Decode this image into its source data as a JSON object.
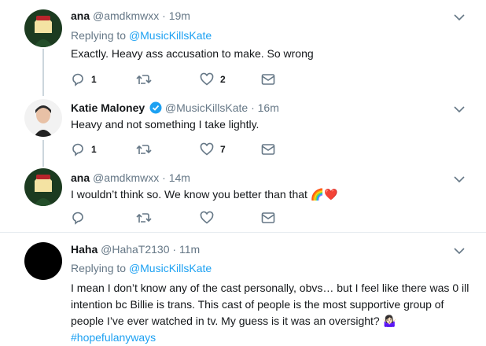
{
  "tweets": [
    {
      "name": "ana",
      "handle": "@amdkmwxx",
      "dot": "·",
      "time": "19m",
      "replying_prefix": "Replying to ",
      "replying_to": "@MusicKillsKate",
      "text": "Exactly. Heavy ass accusation to make. So wrong",
      "reply_count": "1",
      "retweet_count": "",
      "like_count": "2"
    },
    {
      "name": "Katie Maloney",
      "handle": "@MusicKillsKate",
      "dot": "·",
      "time": "16m",
      "text": "Heavy and not something I take lightly.",
      "reply_count": "1",
      "retweet_count": "",
      "like_count": "7"
    },
    {
      "name": "ana",
      "handle": "@amdkmwxx",
      "dot": "·",
      "time": "14m",
      "text": "I wouldn’t think so. We know you better than that",
      "emoji": "🌈❤️",
      "reply_count": "",
      "retweet_count": "",
      "like_count": ""
    },
    {
      "name": "Haha",
      "handle": "@HahaT2130",
      "dot": "·",
      "time": "11m",
      "replying_prefix": "Replying to ",
      "replying_to": "@MusicKillsKate",
      "text_lines": [
        "I mean I don’t know any of the cast personally, obvs… but I feel like there was 0 ill",
        "intention bc Billie is trans.  This cast of people is the most supportive group of",
        "people I’ve ever watched in tv.  My guess is it was an oversight? 🤷🏻‍♀️"
      ],
      "hashtag": "#hopefulanyways"
    }
  ],
  "icons": [
    "chevron-down-icon",
    "reply-icon",
    "retweet-icon",
    "like-icon",
    "dm-icon",
    "verified-icon"
  ],
  "colors": {
    "link": "#1da1f2",
    "muted": "#657786",
    "thread_line": "#ccd6dd",
    "text": "#14171a"
  }
}
